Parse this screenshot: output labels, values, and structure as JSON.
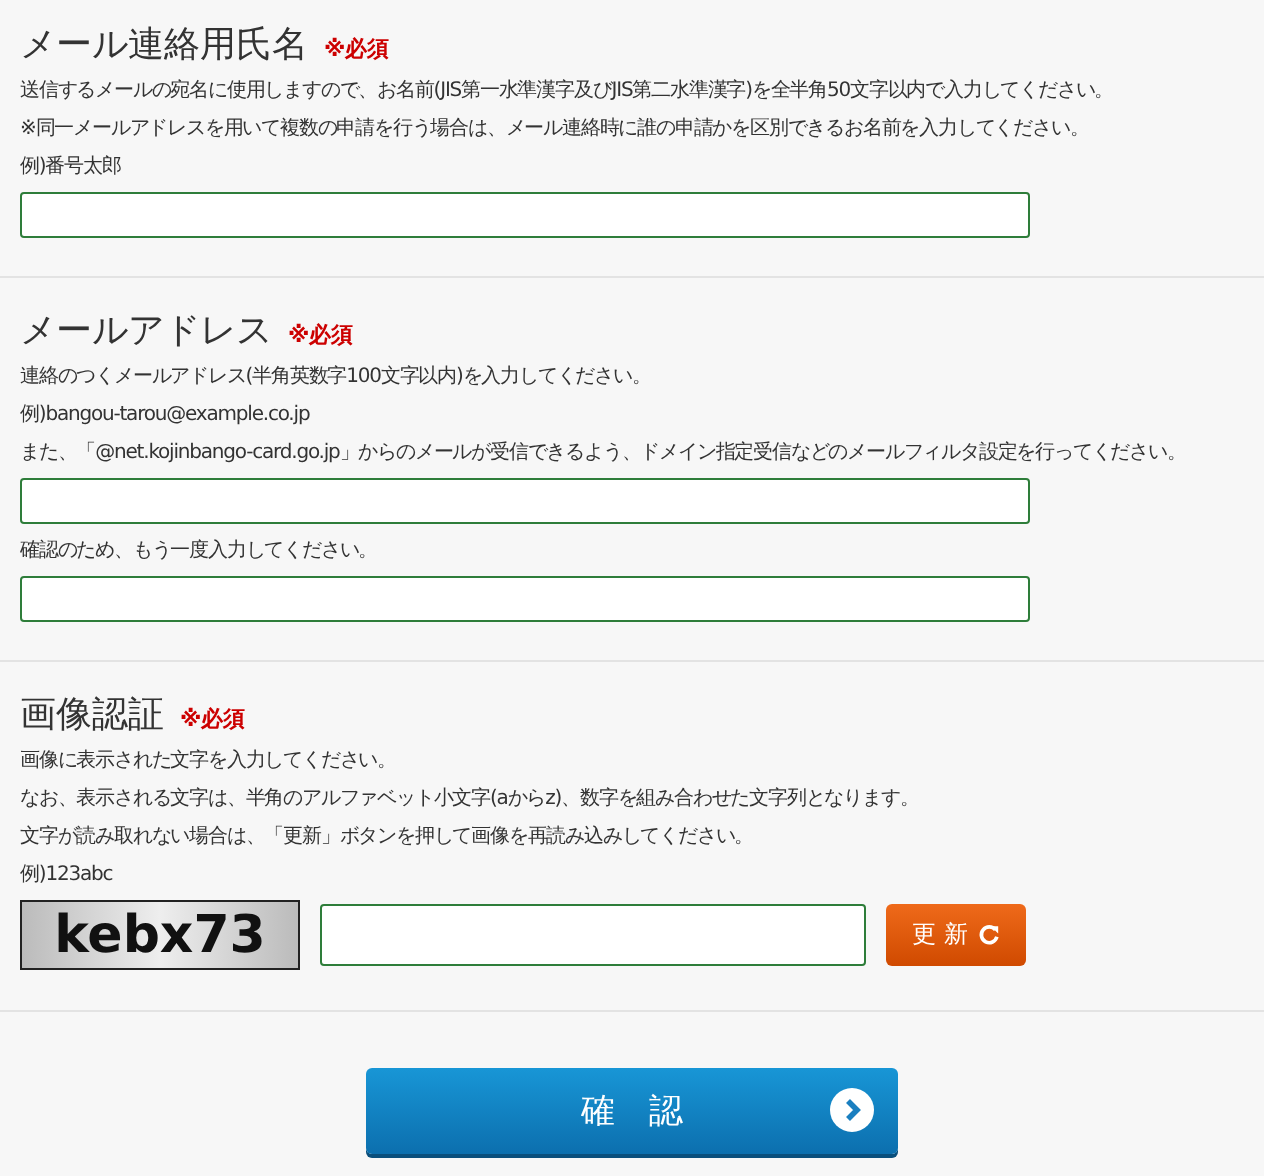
{
  "sections": [
    {
      "title": "メール連絡用氏名",
      "required": "※必須",
      "items": [
        {
          "kind": "note",
          "text": "送信するメールの宛名に使用しますので、お名前(JIS第一水準漢字及びJIS第二水準漢字)を全半角50文字以内で入力してください。"
        },
        {
          "kind": "note",
          "text": "※同一メールアドレスを用いて複数の申請を行う場合は、メール連絡時に誰の申請かを区別できるお名前を入力してください。"
        },
        {
          "kind": "note",
          "text": "例)番号太郎"
        },
        {
          "kind": "input"
        }
      ]
    },
    {
      "title": "メールアドレス",
      "required": "※必須",
      "items": [
        {
          "kind": "note",
          "text": "連絡のつくメールアドレス(半角英数字100文字以内)を入力してください。"
        },
        {
          "kind": "note",
          "text": "例)bangou-tarou@example.co.jp"
        },
        {
          "kind": "note",
          "text": "また、「@net.kojinbango-card.go.jp」からのメールが受信できるよう、ドメイン指定受信などのメールフィルタ設定を行ってください。"
        },
        {
          "kind": "input"
        },
        {
          "kind": "note",
          "text": "確認のため、もう一度入力してください。"
        },
        {
          "kind": "input"
        }
      ]
    },
    {
      "title": "画像認証",
      "required": "※必須",
      "items": [
        {
          "kind": "note",
          "text": "画像に表示された文字を入力してください。"
        },
        {
          "kind": "note",
          "text": "なお、表示される文字は、半角のアルファベット小文字(aからz)、数字を組み合わせた文字列となります。"
        },
        {
          "kind": "note",
          "text": "文字が読み取れない場合は、「更新」ボタンを押して画像を再読み込みしてください。"
        },
        {
          "kind": "note",
          "text": "例)123abc"
        },
        {
          "kind": "captcha",
          "image_text": "kebx73",
          "button": "更 新"
        }
      ]
    }
  ],
  "submit": "確　認"
}
